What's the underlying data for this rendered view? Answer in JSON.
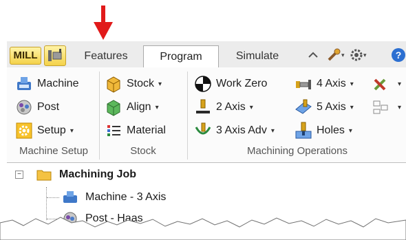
{
  "tabs": {
    "mill": "MILL",
    "features": "Features",
    "program": "Program",
    "simulate": "Simulate"
  },
  "ribbon": {
    "machine_setup": {
      "machine": "Machine",
      "post": "Post",
      "setup": "Setup",
      "group_label": "Machine Setup"
    },
    "stock": {
      "stock": "Stock",
      "align": "Align",
      "material": "Material",
      "group_label": "Stock"
    },
    "machining_operations": {
      "work_zero": "Work Zero",
      "two_axis": "2 Axis",
      "three_axis_adv": "3 Axis Adv",
      "four_axis": "4 Axis",
      "five_axis": "5 Axis",
      "holes": "Holes",
      "group_label": "Machining Operations"
    },
    "dropdown_glyph": "▾"
  },
  "tree": {
    "root": "Machining Job",
    "children": [
      "Machine - 3 Axis",
      "Post - Haas"
    ],
    "expander": "−"
  },
  "colors": {
    "annotation_arrow": "#e11a1a",
    "tab_highlight": "#f4d24a",
    "ribbon_background": "#fbfbfb"
  }
}
